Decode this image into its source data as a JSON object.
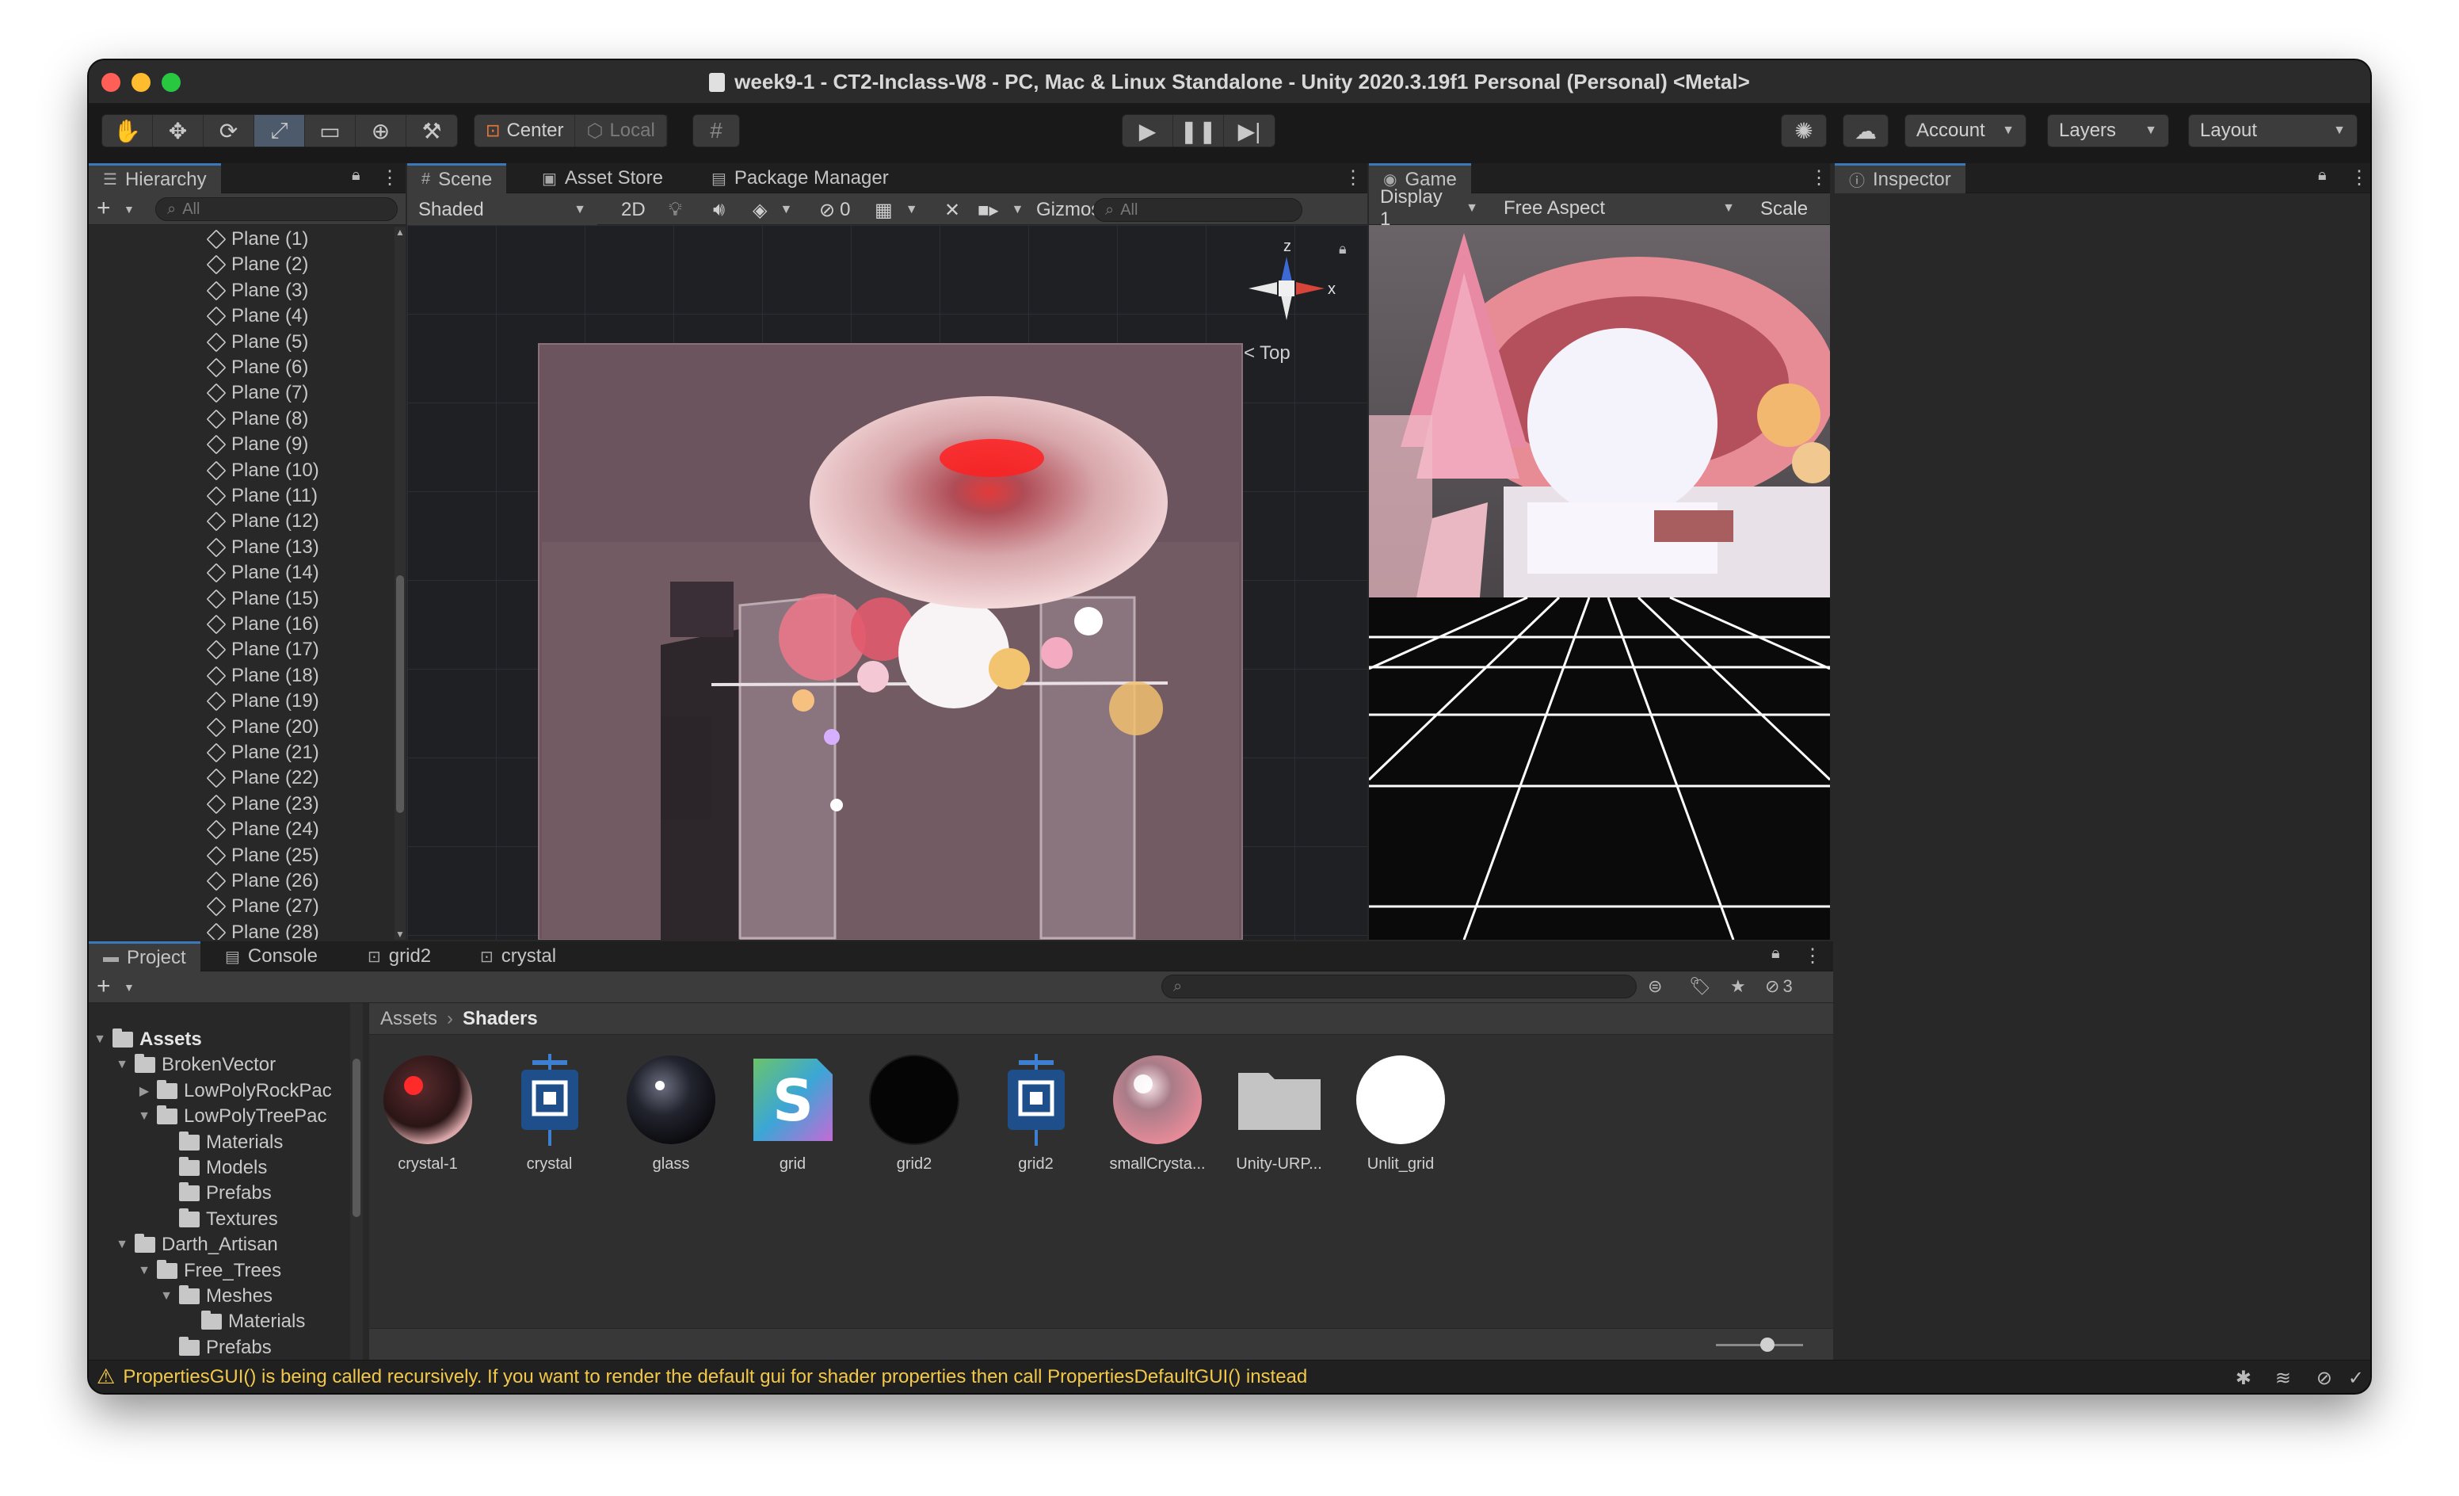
{
  "window": {
    "title": "week9-1 - CT2-Inclass-W8 - PC, Mac & Linux Standalone - Unity 2020.3.19f1 Personal (Personal) <Metal>"
  },
  "toolbar": {
    "pivot_label": "Center",
    "space_label": "Local",
    "account_label": "Account",
    "layers_label": "Layers",
    "layout_label": "Layout"
  },
  "hierarchy": {
    "tab_label": "Hierarchy",
    "search_placeholder": "All",
    "items": [
      "Plane (1)",
      "Plane (2)",
      "Plane (3)",
      "Plane (4)",
      "Plane (5)",
      "Plane (6)",
      "Plane (7)",
      "Plane (8)",
      "Plane (9)",
      "Plane (10)",
      "Plane (11)",
      "Plane (12)",
      "Plane (13)",
      "Plane (14)",
      "Plane (15)",
      "Plane (16)",
      "Plane (17)",
      "Plane (18)",
      "Plane (19)",
      "Plane (20)",
      "Plane (21)",
      "Plane (22)",
      "Plane (23)",
      "Plane (24)",
      "Plane (25)",
      "Plane (26)",
      "Plane (27)",
      "Plane (28)"
    ]
  },
  "scene": {
    "tabs": [
      "Scene",
      "Asset Store",
      "Package Manager"
    ],
    "shading_mode": "Shaded",
    "mode_2d": "2D",
    "hidden_count": "0",
    "gizmos_label": "Gizmos",
    "search_placeholder": "All",
    "gizmo_z": "z",
    "gizmo_x": "x",
    "view_label": "Top"
  },
  "game": {
    "tab_label": "Game",
    "display": "Display 1",
    "aspect": "Free Aspect",
    "scale_label": "Scale"
  },
  "inspector": {
    "tab_label": "Inspector"
  },
  "project": {
    "tabs": [
      "Project",
      "Console",
      "grid2",
      "crystal"
    ],
    "visible_count": "3",
    "breadcrumb": [
      "Assets",
      "Shaders"
    ],
    "tree": [
      {
        "label": "Assets",
        "depth": 0,
        "expanded": true,
        "bold": true
      },
      {
        "label": "BrokenVector",
        "depth": 1,
        "expanded": true
      },
      {
        "label": "LowPolyRockPac",
        "depth": 2,
        "expanded": false
      },
      {
        "label": "LowPolyTreePac",
        "depth": 2,
        "expanded": true
      },
      {
        "label": "Materials",
        "depth": 3
      },
      {
        "label": "Models",
        "depth": 3
      },
      {
        "label": "Prefabs",
        "depth": 3
      },
      {
        "label": "Textures",
        "depth": 3
      },
      {
        "label": "Darth_Artisan",
        "depth": 1,
        "expanded": true
      },
      {
        "label": "Free_Trees",
        "depth": 2,
        "expanded": true
      },
      {
        "label": "Meshes",
        "depth": 3,
        "expanded": true
      },
      {
        "label": "Materials",
        "depth": 4
      },
      {
        "label": "Prefabs",
        "depth": 3
      }
    ],
    "assets": [
      {
        "label": "crystal-1",
        "kind": "material-red"
      },
      {
        "label": "crystal",
        "kind": "shader-graph"
      },
      {
        "label": "glass",
        "kind": "material-dark"
      },
      {
        "label": "grid",
        "kind": "shader"
      },
      {
        "label": "grid2",
        "kind": "material-black"
      },
      {
        "label": "grid2",
        "kind": "shader-graph"
      },
      {
        "label": "smallCrysta...",
        "kind": "material-pink"
      },
      {
        "label": "Unity-URP...",
        "kind": "folder"
      },
      {
        "label": "Unlit_grid",
        "kind": "material-white"
      }
    ]
  },
  "status": {
    "message": "PropertiesGUI() is being called recursively. If you want to render the default gui for shader properties then call PropertiesDefaultGUI() instead"
  },
  "colors": {
    "accent_blue": "#3a79bb",
    "warning": "#f2c84b"
  }
}
